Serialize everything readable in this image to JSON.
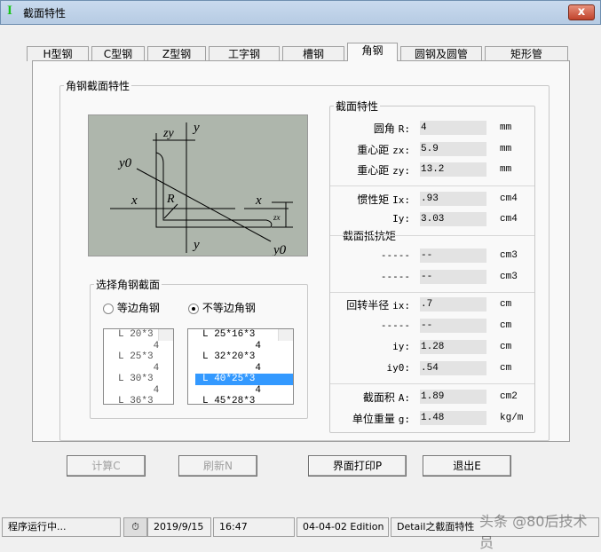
{
  "window": {
    "title": "截面特性",
    "close": "x"
  },
  "tabs": [
    {
      "label": "H型钢"
    },
    {
      "label": "C型钢"
    },
    {
      "label": "Z型钢"
    },
    {
      "label": "工字钢"
    },
    {
      "label": "槽钢"
    },
    {
      "label": "角钢",
      "active": true
    },
    {
      "label": "圆钢及圆管"
    },
    {
      "label": "矩形管"
    }
  ],
  "main_group": "角钢截面特性",
  "diagram": {
    "labels": {
      "y_top": "y",
      "y_bottom": "y",
      "x_left": "x",
      "x_right": "x",
      "y0_top": "y0",
      "y0_bottom": "y0",
      "zy": "zy",
      "zx": "zx",
      "R": "R"
    }
  },
  "select": {
    "title": "选择角钢截面",
    "radio_equal": "等边角钢",
    "radio_unequal": "不等边角钢",
    "selected": "unequal",
    "equal_list": [
      "L 20*3",
      "      4",
      "L 25*3",
      "      4",
      "L 30*3",
      "      4",
      "L 36*3"
    ],
    "unequal_list": [
      "L 25*16*3",
      "         4",
      "L 32*20*3",
      "         4",
      "L 40*25*3",
      "         4",
      "L 45*28*3"
    ],
    "unequal_selected_index": 4
  },
  "props": {
    "title": "截面特性",
    "sub_title": "截面抵抗矩",
    "rows": [
      {
        "cn": "圆角",
        "sym": "R:",
        "value": "4",
        "unit": "mm"
      },
      {
        "cn": "重心距",
        "sym": "zx:",
        "value": "5.9",
        "unit": "mm"
      },
      {
        "cn": "重心距",
        "sym": "zy:",
        "value": "13.2",
        "unit": "mm"
      },
      {
        "cn": "惯性矩",
        "sym": "Ix:",
        "value": ".93",
        "unit": "cm4"
      },
      {
        "cn": "",
        "sym": "Iy:",
        "value": "3.03",
        "unit": "cm4"
      },
      {
        "cn": "",
        "sym": "-----",
        "value": "--",
        "unit": "cm3"
      },
      {
        "cn": "",
        "sym": "-----",
        "value": "--",
        "unit": "cm3"
      },
      {
        "cn": "回转半径",
        "sym": "ix:",
        "value": ".7",
        "unit": "cm"
      },
      {
        "cn": "",
        "sym": "-----",
        "value": "--",
        "unit": "cm"
      },
      {
        "cn": "",
        "sym": "iy:",
        "value": "1.28",
        "unit": "cm"
      },
      {
        "cn": "",
        "sym": "iy0:",
        "value": ".54",
        "unit": "cm"
      },
      {
        "cn": "截面积",
        "sym": "A:",
        "value": "1.89",
        "unit": "cm2"
      },
      {
        "cn": "单位重量",
        "sym": "g:",
        "value": "1.48",
        "unit": "kg/m"
      }
    ]
  },
  "buttons": {
    "calc": "计算C",
    "refresh": "刷新N",
    "print": "界面打印P",
    "exit": "退出E"
  },
  "status": {
    "state": "程序运行中...",
    "date": "2019/9/15",
    "time": "16:47",
    "edition": "04-04-02 Edition",
    "module": "Detail之截面特性"
  },
  "watermark": "头条 @80后技术员"
}
